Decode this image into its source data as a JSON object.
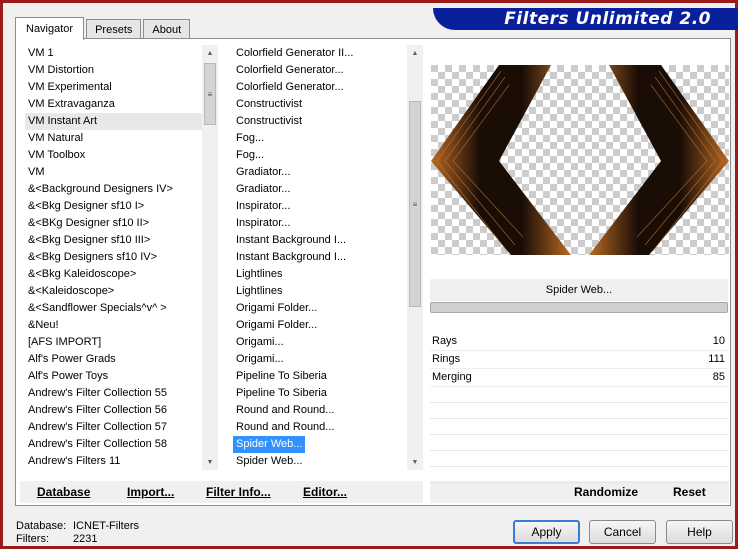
{
  "window": {
    "title": "Filters Unlimited 2.0"
  },
  "tabs": [
    {
      "label": "Navigator",
      "active": true
    },
    {
      "label": "Presets",
      "active": false
    },
    {
      "label": "About",
      "active": false
    }
  ],
  "categories": [
    "VM 1",
    "VM Distortion",
    "VM Experimental",
    "VM Extravaganza",
    "VM Instant Art",
    "VM Natural",
    "VM Toolbox",
    "VM",
    "&<Background Designers IV>",
    "&<Bkg Designer sf10 I>",
    "&<BKg Designer sf10 II>",
    "&<Bkg Designer sf10 III>",
    "&<Bkg Designers sf10 IV>",
    "&<Bkg Kaleidoscope>",
    "&<Kaleidoscope>",
    "&<Sandflower Specials^v^ >",
    "&Neu!",
    "[AFS IMPORT]",
    "Alf's Power Grads",
    "Alf's Power Toys",
    "Andrew's Filter Collection 55",
    "Andrew's Filter Collection 56",
    "Andrew's Filter Collection 57",
    "Andrew's Filter Collection 58",
    "Andrew's Filters 11"
  ],
  "selected_category": "VM Instant Art",
  "filters": [
    "Colorfield Generator II...",
    "Colorfield Generator...",
    "Colorfield Generator...",
    "Constructivist",
    "Constructivist",
    "Fog...",
    "Fog...",
    "Gradiator...",
    "Gradiator...",
    "Inspirator...",
    "Inspirator...",
    "Instant Background I...",
    "Instant Background I...",
    "Lightlines",
    "Lightlines",
    "Origami Folder...",
    "Origami Folder...",
    "Origami...",
    "Origami...",
    "Pipeline To Siberia",
    "Pipeline To Siberia",
    "Round and Round...",
    "Round and Round...",
    "Spider Web...",
    "Spider Web..."
  ],
  "selected_filter": "Spider Web...",
  "list_buttons": {
    "database": "Database",
    "import": "Import...",
    "filter_info": "Filter Info...",
    "editor": "Editor..."
  },
  "current_filter": {
    "name": "Spider Web..."
  },
  "parameters": [
    {
      "label": "Rays",
      "value": "10"
    },
    {
      "label": "Rings",
      "value": "111"
    },
    {
      "label": "Merging",
      "value": "85"
    }
  ],
  "param_buttons": {
    "randomize": "Randomize",
    "reset": "Reset"
  },
  "info": {
    "database_label": "Database:",
    "database_value": "ICNET-Filters",
    "filters_label": "Filters:",
    "filters_value": "2231"
  },
  "dialog_buttons": {
    "apply": "Apply",
    "cancel": "Cancel",
    "help": "Help"
  },
  "colors": {
    "frame": "#9b1a1a",
    "banner": "#0a1f9c",
    "selection": "#3390ff"
  }
}
